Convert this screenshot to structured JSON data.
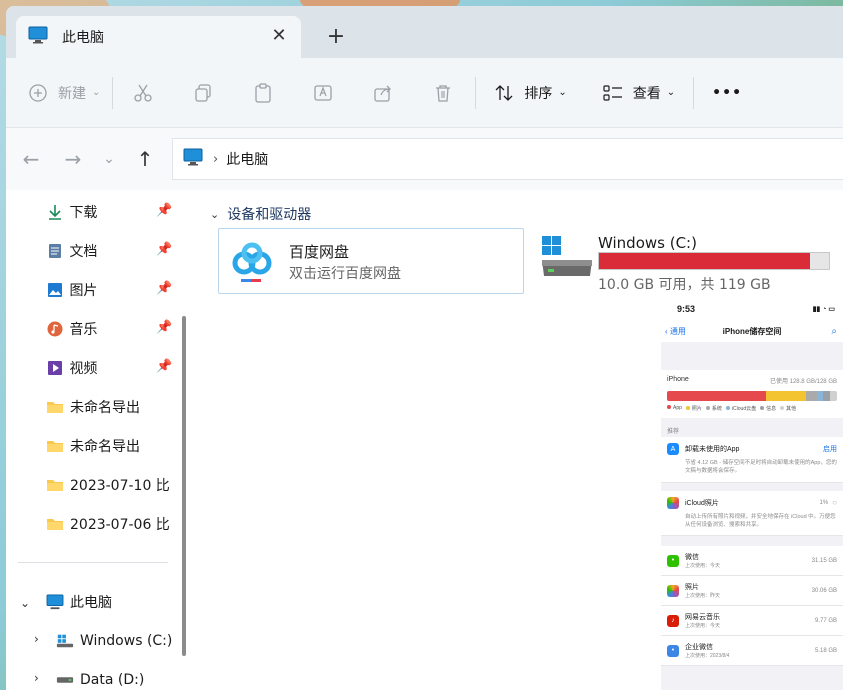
{
  "tab": {
    "title": "此电脑",
    "close_glyph": "✕",
    "new_glyph": "+"
  },
  "toolbar": {
    "new_label": "新建",
    "sort_label": "排序",
    "view_label": "查看",
    "more_glyph": "•••"
  },
  "address": {
    "path": "此电脑"
  },
  "sidebar": {
    "items": [
      {
        "label": "下载",
        "icon": "download-icon"
      },
      {
        "label": "文档",
        "icon": "document-icon"
      },
      {
        "label": "图片",
        "icon": "pictures-icon"
      },
      {
        "label": "音乐",
        "icon": "music-icon"
      },
      {
        "label": "视频",
        "icon": "video-icon"
      },
      {
        "label": "未命名导出",
        "icon": "folder-icon"
      },
      {
        "label": "未命名导出",
        "icon": "folder-icon"
      },
      {
        "label": "2023-07-10 比",
        "icon": "folder-icon"
      },
      {
        "label": "2023-07-06 比",
        "icon": "folder-icon"
      }
    ],
    "tree": [
      {
        "label": "此电脑",
        "icon": "pc-icon"
      },
      {
        "label": "Windows (C:)",
        "icon": "windows-drive-icon"
      },
      {
        "label": "Data (D:)",
        "icon": "drive-icon"
      }
    ]
  },
  "main": {
    "section_title": "设备和驱动器",
    "tile": {
      "name": "百度网盘",
      "sub": "双击运行百度网盘"
    },
    "drive": {
      "name": "Windows (C:)",
      "sub": "10.0 GB 可用，共 119 GB",
      "used_fraction": 0.916
    }
  },
  "phone": {
    "time": "9:53",
    "back_label": "通用",
    "title": "iPhone储存空间",
    "device": "iPhone",
    "used": "已使用 128.8 GB/128 GB",
    "legend": [
      "App",
      "照片",
      "系统",
      "iCloud云盘",
      "信息",
      "其他"
    ],
    "recommend_label": "推荐",
    "offload": {
      "title": "卸载未使用的App",
      "action": "启用",
      "desc": "节省 4.12 GB - 储存空间不足时将自动卸载未使用的App，您的文稿与数据将会保存。"
    },
    "icloud": {
      "title": "iCloud照片",
      "value": "1%",
      "desc": "自动上传所有照片和视频，并安全地保存在 iCloud 中。万便您从任何设备浏览、搜索和共享。"
    },
    "apps": [
      {
        "name": "微信",
        "sub": "上次使用：今天",
        "size": "31.15 GB",
        "color": "#2dc100"
      },
      {
        "name": "照片",
        "sub": "上次使用：昨天",
        "size": "30.06 GB",
        "color": "#f5a623"
      },
      {
        "name": "网易云音乐",
        "sub": "上次使用：今天",
        "size": "9.77 GB",
        "color": "#d81e06"
      },
      {
        "name": "企业微信",
        "sub": "上次使用：2023/8/4",
        "size": "5.18 GB",
        "color": "#3c86e5"
      }
    ]
  },
  "colors": {
    "accent": "#0067c0",
    "drive_fill": "#da2c38",
    "tile_border": "#b9d6ee"
  }
}
